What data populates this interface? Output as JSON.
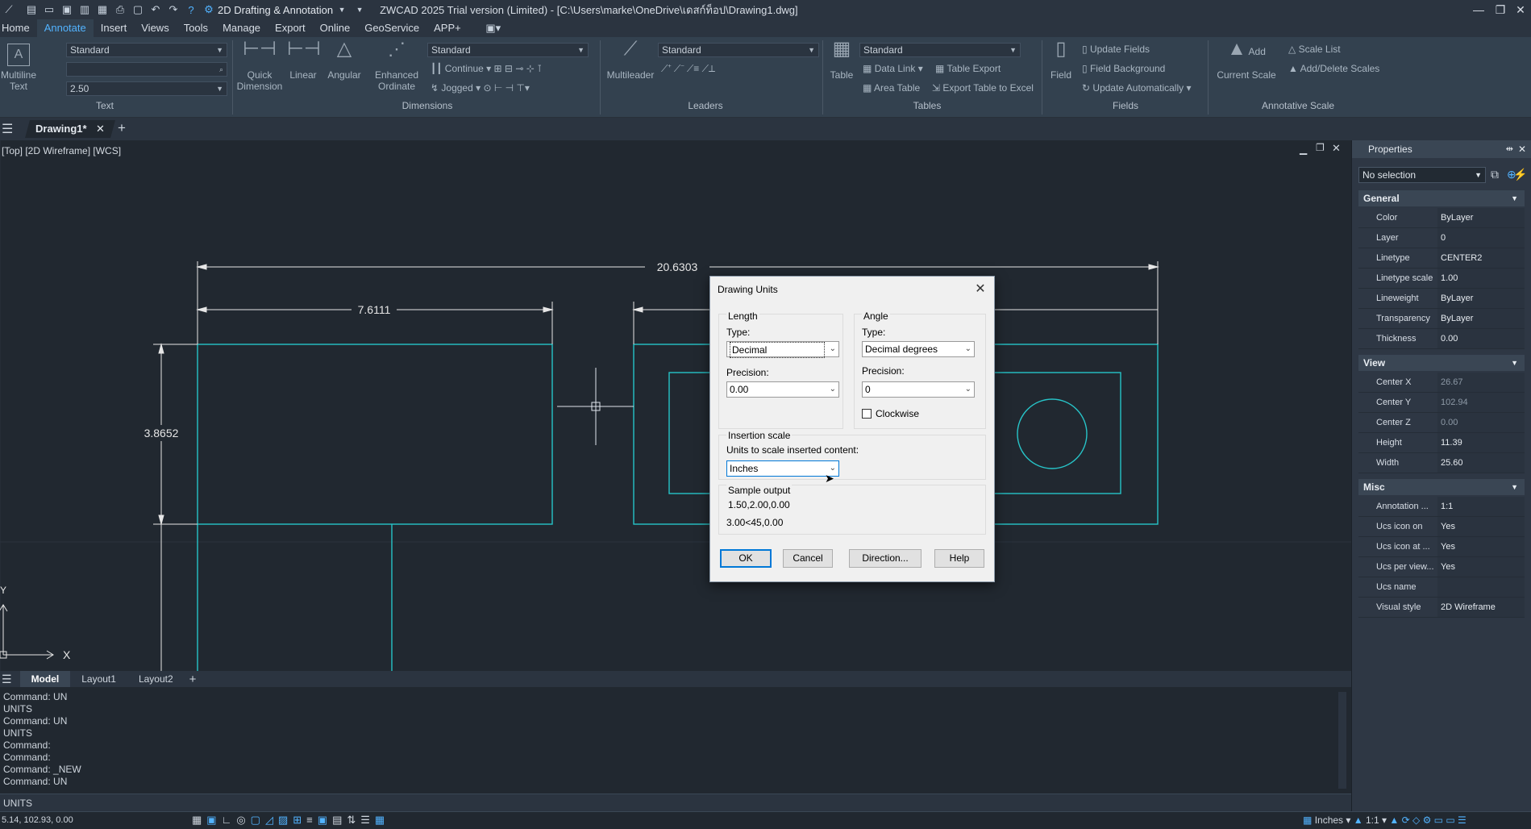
{
  "titlebar": {
    "workspace": "2D Drafting & Annotation",
    "title": "ZWCAD 2025 Trial version (Limited) - [C:\\Users\\marke\\OneDrive\\เดสก์ท็อป\\Drawing1.dwg]"
  },
  "menu": [
    "Home",
    "Annotate",
    "Insert",
    "Views",
    "Tools",
    "Manage",
    "Export",
    "Online",
    "GeoService",
    "APP+"
  ],
  "menu_active": "Annotate",
  "ribbon": {
    "text": {
      "style": "Standard",
      "height": "2.50",
      "multiline_text": "Multiline Text",
      "label": "Text"
    },
    "dimensions": {
      "quick": "Quick Dimension",
      "linear": "Linear",
      "angular": "Angular",
      "enhanced": "Enhanced Ordinate",
      "style": "Standard",
      "continue": "Continue",
      "jogged": "Jogged",
      "label": "Dimensions"
    },
    "leaders": {
      "multileader": "Multileader",
      "style": "Standard",
      "label": "Leaders"
    },
    "tables": {
      "table": "Table",
      "style": "Standard",
      "data_link": "Data Link",
      "table_export": "Table Export",
      "area_table": "Area Table",
      "export_excel": "Export Table to Excel",
      "label": "Tables"
    },
    "fields": {
      "field": "Field",
      "update_fields": "Update Fields",
      "field_background": "Field Background",
      "update_automatically": "Update Automatically",
      "label": "Fields"
    },
    "annotative": {
      "add_scale": "Add Current Scale",
      "scale_list": "Scale List",
      "add_delete": "Add/Delete Scales",
      "label": "Annotative Scale"
    }
  },
  "doc_tab": "Drawing1*",
  "viewport_label": "[Top] [2D Wireframe] [WCS]",
  "drawing": {
    "dim_total": "20.6303",
    "dim_left": "7.6111",
    "dim_height": "3.8652",
    "axis_x": "X",
    "axis_y": "Y"
  },
  "layout_tabs": [
    "Model",
    "Layout1",
    "Layout2"
  ],
  "command_history": [
    "Command: UN",
    "UNITS",
    "Command: UN",
    "UNITS",
    "Command:",
    "Command:",
    "Command: _NEW",
    "Command: UN"
  ],
  "command_input": "UNITS",
  "status": {
    "coords": "5.14, 102.93, 0.00",
    "units": "Inches",
    "scale": "1:1"
  },
  "properties": {
    "header": "Properties",
    "selection": "No selection",
    "categories": {
      "general": {
        "label": "General",
        "rows": [
          {
            "k": "Color",
            "v": "ByLayer"
          },
          {
            "k": "Layer",
            "v": "0"
          },
          {
            "k": "Linetype",
            "v": "CENTER2"
          },
          {
            "k": "Linetype scale",
            "v": "1.00"
          },
          {
            "k": "Lineweight",
            "v": "ByLayer"
          },
          {
            "k": "Transparency",
            "v": "ByLayer"
          },
          {
            "k": "Thickness",
            "v": "0.00"
          }
        ]
      },
      "view": {
        "label": "View",
        "rows": [
          {
            "k": "Center X",
            "v": "26.67"
          },
          {
            "k": "Center Y",
            "v": "102.94"
          },
          {
            "k": "Center Z",
            "v": "0.00"
          },
          {
            "k": "Height",
            "v": "11.39"
          },
          {
            "k": "Width",
            "v": "25.60"
          }
        ]
      },
      "misc": {
        "label": "Misc",
        "rows": [
          {
            "k": "Annotation ...",
            "v": "1:1"
          },
          {
            "k": "Ucs icon on",
            "v": "Yes"
          },
          {
            "k": "Ucs icon at ...",
            "v": "Yes"
          },
          {
            "k": "Ucs per view...",
            "v": "Yes"
          },
          {
            "k": "Ucs name",
            "v": ""
          },
          {
            "k": "Visual style",
            "v": "2D Wireframe"
          }
        ]
      }
    }
  },
  "dialog": {
    "title": "Drawing Units",
    "length": {
      "label": "Length",
      "type_label": "Type:",
      "type_value": "Decimal",
      "precision_label": "Precision:",
      "precision_value": "0.00"
    },
    "angle": {
      "label": "Angle",
      "type_label": "Type:",
      "type_value": "Decimal degrees",
      "precision_label": "Precision:",
      "precision_value": "0",
      "clockwise": "Clockwise"
    },
    "insertion": {
      "label": "Insertion scale",
      "sublabel": "Units to scale inserted content:",
      "value": "Inches"
    },
    "sample": {
      "label": "Sample output",
      "line1": "1.50,2.00,0.00",
      "line2": "3.00<45,0.00"
    },
    "buttons": {
      "ok": "OK",
      "cancel": "Cancel",
      "direction": "Direction...",
      "help": "Help"
    }
  },
  "colors": {
    "drawing_line": "#27c4c8",
    "dim_line": "#e6e6e6",
    "accent": "#52b3ff",
    "dialog_focus": "#0078d7"
  }
}
